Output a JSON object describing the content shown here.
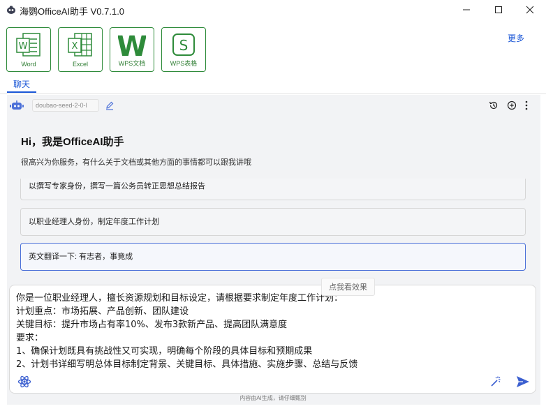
{
  "window": {
    "title": "海鹦OfficeAI助手 V0.7.1.0",
    "minimize_label": "minimize",
    "maximize_label": "maximize",
    "close_label": "close"
  },
  "apps": {
    "items": [
      {
        "label": "Word",
        "glyph": "W",
        "icon": "word-doc-icon"
      },
      {
        "label": "Excel",
        "glyph": "X",
        "icon": "excel-sheet-icon"
      },
      {
        "label": "WPS文档",
        "glyph": "W",
        "icon": "wps-writer-icon"
      },
      {
        "label": "WPS表格",
        "glyph": "S",
        "icon": "wps-spreadsheet-icon"
      }
    ],
    "more_label": "更多"
  },
  "tabs": {
    "chat_label": "聊天"
  },
  "toolbar": {
    "model_value": "doubao-seed-2-0-l"
  },
  "greeting": {
    "title": "Hi，我是OfficeAI助手",
    "subtitle": "很高兴为你服务，有什么关于文档或其他方面的事情都可以跟我讲哦"
  },
  "suggestions": [
    "以撰写专家身份，撰写一篇公务员转正思想总结报告",
    "以职业经理人身份，制定年度工作计划",
    "英文翻译一下: 有志者，事竟成"
  ],
  "tooltip": "点我看效果",
  "input": {
    "lines": [
      "你是一位职业经理人，擅长资源规划和目标设定，请根据要求制定年度工作计划：",
      "计划重点：市场拓展、产品创新、团队建设",
      "关键目标：提升市场占有率10%、发布3款新产品、提高团队满意度",
      "要求：",
      "1、确保计划既具有挑战性又可实现，明确每个阶段的具体目标和预期成果",
      "2、计划书详细写明总体目标制定背景、关键目标、具体措施、实施步骤、总结与反馈"
    ]
  },
  "footer": {
    "disclaimer": "内容由AI生成，请仔细甄别"
  },
  "colors": {
    "brand_green": "#2e8b3a",
    "accent_blue": "#1a56d6",
    "panel_bg": "#f2f3f5"
  }
}
